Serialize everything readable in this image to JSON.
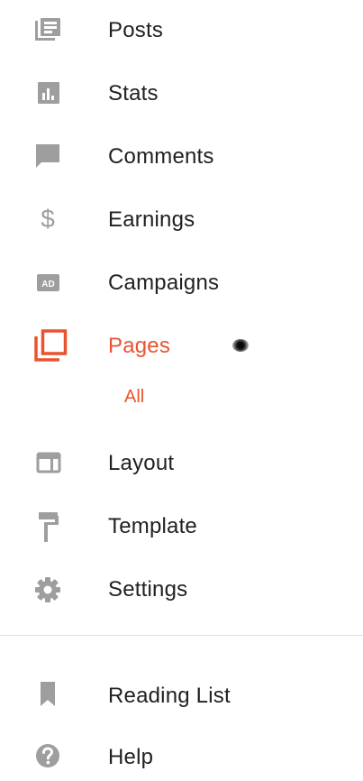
{
  "colors": {
    "icon": "#9e9e9e",
    "text": "#212121",
    "accent": "#e8542f",
    "divider": "#e0e0e0"
  },
  "nav": {
    "items": [
      {
        "label": "Posts",
        "icon": "posts-icon"
      },
      {
        "label": "Stats",
        "icon": "stats-icon"
      },
      {
        "label": "Comments",
        "icon": "comment-icon"
      },
      {
        "label": "Earnings",
        "icon": "dollar-icon",
        "glyph": "$"
      },
      {
        "label": "Campaigns",
        "icon": "ad-icon"
      },
      {
        "label": "Pages",
        "icon": "pages-icon",
        "active": true
      },
      {
        "label": "Layout",
        "icon": "layout-icon"
      },
      {
        "label": "Template",
        "icon": "paint-roller-icon"
      },
      {
        "label": "Settings",
        "icon": "gear-icon"
      }
    ],
    "pages_sub": {
      "label": "All"
    }
  },
  "footer": {
    "items": [
      {
        "label": "Reading List",
        "icon": "bookmark-icon"
      },
      {
        "label": "Help",
        "icon": "help-icon"
      }
    ]
  }
}
